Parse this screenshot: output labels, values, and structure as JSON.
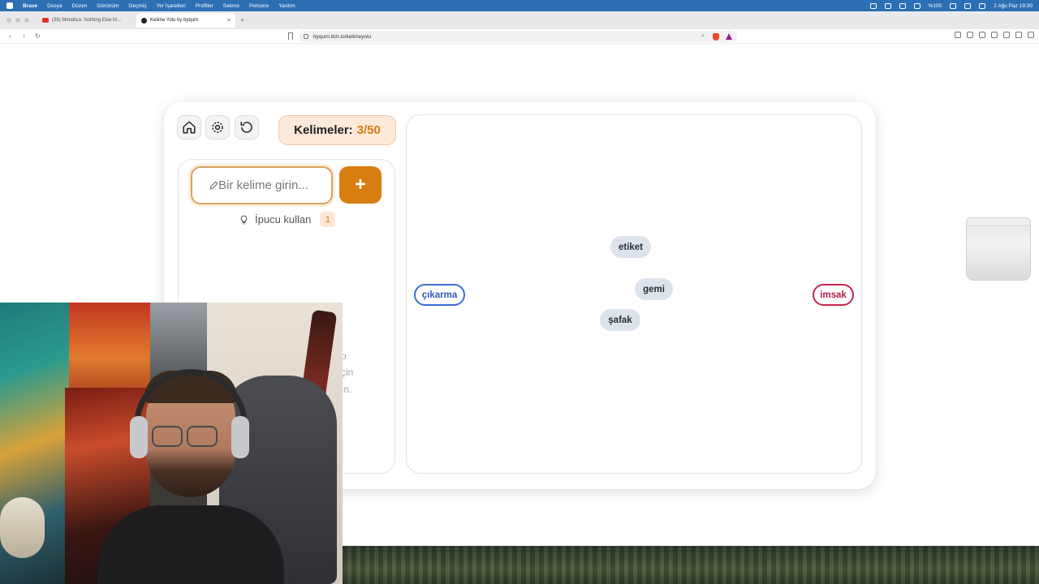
{
  "menubar": {
    "app": "Brave",
    "items": [
      "Dosya",
      "Düzen",
      "Görünüm",
      "Geçmiş",
      "Yer İşaretleri",
      "Profiller",
      "Sekme",
      "Pencere",
      "Yardım"
    ],
    "battery": "%100",
    "datetime": "2 Ağu Paz 19:30"
  },
  "tabs": [
    {
      "title": "(36) Metallica: Nothing Else M..."
    },
    {
      "title": "Kelime Yolu by byqurn"
    }
  ],
  "address": {
    "url": "byqurn.itch.io/kelimeyolu"
  },
  "game": {
    "counter_label": "Kelimeler:",
    "counter_value": "3/50",
    "input_placeholder": "Bir kelime girin...",
    "add_label": "+",
    "hint_label": "İpucu kullan",
    "hint_count": "1",
    "stray_text": [
      "o",
      "çin",
      "ın."
    ],
    "words": {
      "start": "çıkarma",
      "end": "imsak",
      "nodes": [
        "etiket",
        "gemi",
        "şafak"
      ]
    }
  }
}
